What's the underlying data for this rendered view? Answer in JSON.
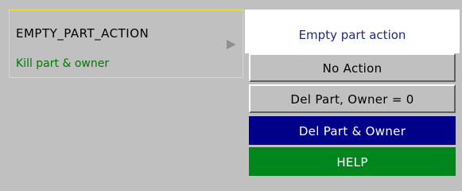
{
  "field": {
    "name": "EMPTY_PART_ACTION",
    "value": "Kill part & owner"
  },
  "menu": {
    "title": "Empty part action",
    "options": [
      "No Action",
      "Del Part, Owner = 0",
      "Del Part & Owner"
    ],
    "selected": "Del Part & Owner",
    "help_label": "HELP"
  },
  "colors": {
    "background": "#c0c0c0",
    "field_border": "#f2e63a",
    "value_text": "#007a00",
    "menu_title_text": "#1a2b8a",
    "selected_bg": "#00008b",
    "help_bg": "#00861d"
  }
}
